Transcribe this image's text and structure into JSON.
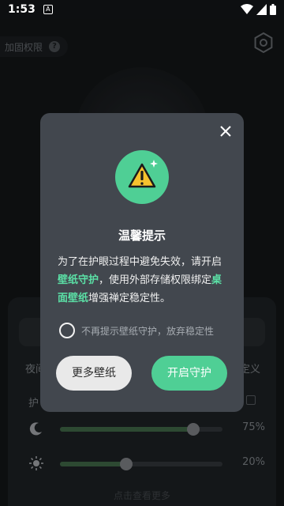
{
  "status_bar": {
    "time": "1:53",
    "notif_glyph": "A",
    "icons": [
      "wifi-icon",
      "signal-icon",
      "battery-icon"
    ]
  },
  "app": {
    "reinforce_label": "加固权限",
    "help_glyph": "?",
    "mode_left_label": "夜间",
    "mode_right_label": "定义",
    "protect_label": "护",
    "night_slider": {
      "value_label": "75%",
      "level": 0.82
    },
    "bright_slider": {
      "value_label": "20%",
      "level": 0.41
    },
    "more_link": "点击查看更多"
  },
  "dialog": {
    "title": "温馨提示",
    "body_part1": "为了在护眼过程中避免失效，请开启",
    "highlight1": "壁纸守护",
    "body_part2": "，使用外部存储权限绑定",
    "highlight2": "桌面壁纸",
    "body_part3": "增强禅定稳定性。",
    "option_label": "不再提示壁纸守护，放弃稳定性",
    "btn_more": "更多壁纸",
    "btn_enable": "开启守护"
  },
  "colors": {
    "accent": "#4fcf95",
    "highlight": "#5be0a6",
    "dialog_bg": "#42474e"
  }
}
